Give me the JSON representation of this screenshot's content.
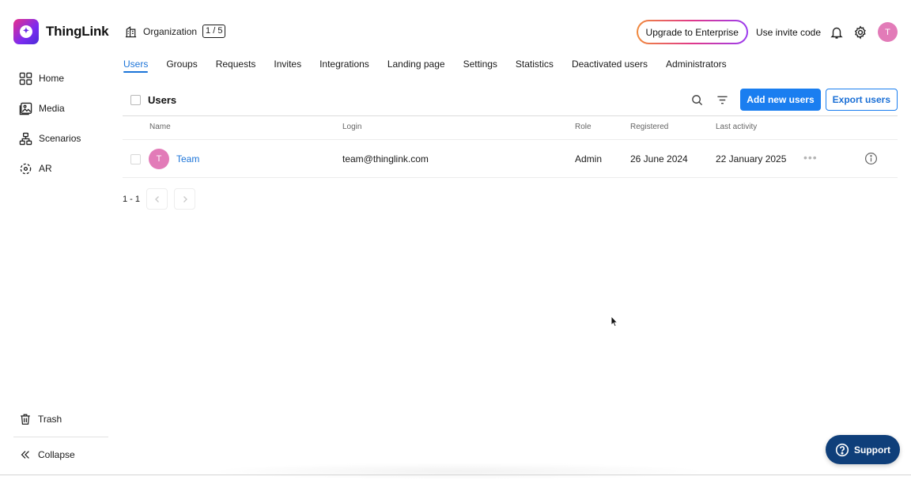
{
  "brand": {
    "name": "ThingLink",
    "accent": "#7b2cf0"
  },
  "sidebar": {
    "items": [
      {
        "id": "home",
        "label": "Home",
        "icon": "grid-icon"
      },
      {
        "id": "media",
        "label": "Media",
        "icon": "image-icon"
      },
      {
        "id": "scenarios",
        "label": "Scenarios",
        "icon": "hierarchy-icon"
      },
      {
        "id": "ar",
        "label": "AR",
        "icon": "ar-icon"
      }
    ],
    "bottom": [
      {
        "id": "trash",
        "label": "Trash",
        "icon": "trash-icon"
      },
      {
        "id": "collapse",
        "label": "Collapse",
        "icon": "double-chevron-left-icon"
      }
    ]
  },
  "header": {
    "org_label": "Organization",
    "org_count": "1 / 5",
    "upgrade_label": "Upgrade to Enterprise",
    "invite_label": "Use invite code",
    "avatar_initial": "T"
  },
  "tabs": [
    {
      "label": "Users",
      "active": true
    },
    {
      "label": "Groups",
      "active": false
    },
    {
      "label": "Requests",
      "active": false
    },
    {
      "label": "Invites",
      "active": false
    },
    {
      "label": "Integrations",
      "active": false
    },
    {
      "label": "Landing page",
      "active": false
    },
    {
      "label": "Settings",
      "active": false
    },
    {
      "label": "Statistics",
      "active": false
    },
    {
      "label": "Deactivated users",
      "active": false
    },
    {
      "label": "Administrators",
      "active": false
    }
  ],
  "toolbar": {
    "title": "Users",
    "add_label": "Add new users",
    "export_label": "Export users"
  },
  "table": {
    "columns": [
      "Name",
      "Login",
      "Role",
      "Registered",
      "Last activity"
    ],
    "rows": [
      {
        "initial": "T",
        "name": "Team",
        "login": "team@thinglink.com",
        "role": "Admin",
        "registered": "26 June 2024",
        "last_activity": "22 January 2025"
      }
    ]
  },
  "pagination": {
    "range": "1 - 1"
  },
  "support": {
    "label": "Support"
  },
  "colors": {
    "primary": "#1a7ef0",
    "link": "#1c74d8",
    "avatar": "#e27bb8",
    "support": "#0f3f7a"
  }
}
